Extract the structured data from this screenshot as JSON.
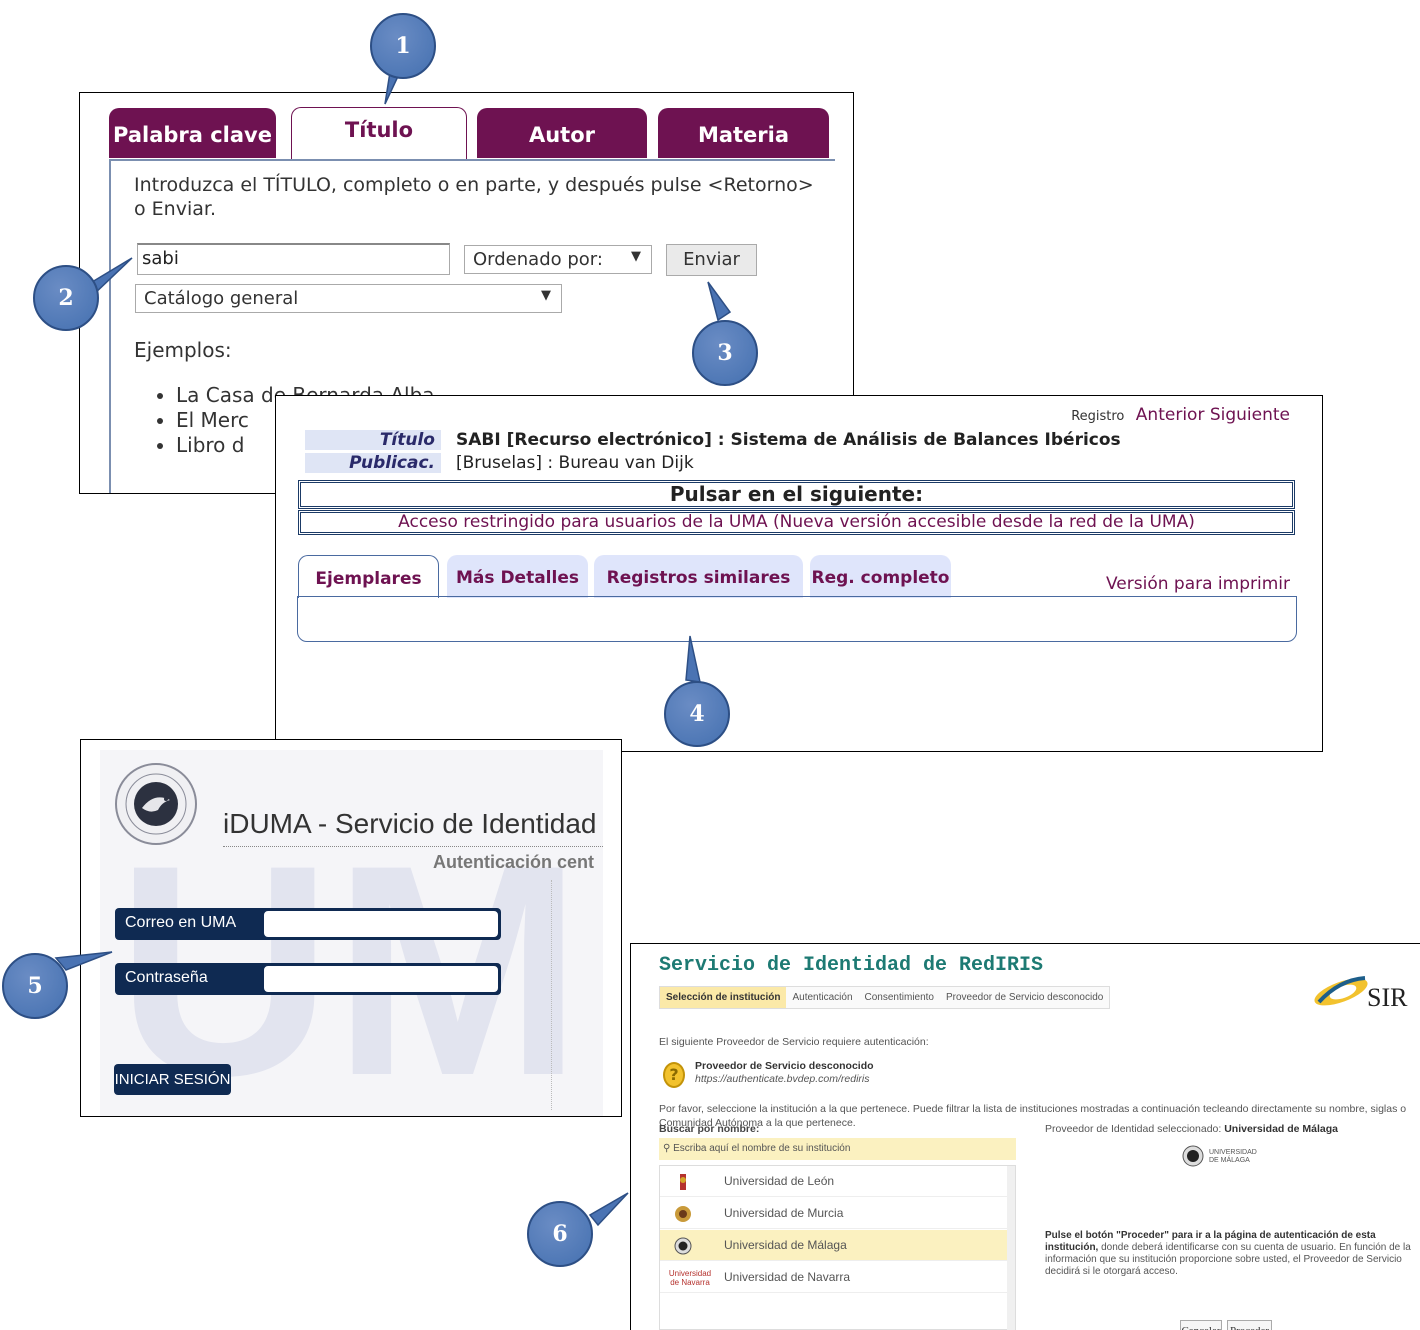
{
  "panel_search": {
    "tabs": [
      "Palabra clave",
      "Título",
      "Autor",
      "Materia"
    ],
    "active_tab": "Título",
    "instruction": "Introduzca el TÍTULO, completo o en parte, y después pulse <Retorno> o Enviar.",
    "search_value": "sabi",
    "sort_label": "Ordenado por:",
    "send_button": "Enviar",
    "catalog_select": "Catálogo general",
    "examples_label": "Ejemplos:",
    "examples": [
      "La Casa de Bernarda Alba",
      "El Merc",
      "Libro d"
    ]
  },
  "panel_record": {
    "nav_label": "Registro",
    "nav_links": "Anterior Siguiente",
    "fields": [
      {
        "label": "Título",
        "value": "SABI [Recurso electrónico] : Sistema de Análisis de Balances Ibéricos"
      },
      {
        "label": "Publicac.",
        "value": "[Bruselas] : Bureau van Dijk"
      }
    ],
    "pulsar_heading": "Pulsar en el siguiente:",
    "access_link": "Acceso restringido para usuarios de la UMA (Nueva versión accesible desde la red de la UMA)",
    "tabs": [
      "Ejemplares",
      "Más Detalles",
      "Registros similares",
      "Reg. completo"
    ],
    "active_tab": "Ejemplares",
    "print_link": "Versión para imprimir"
  },
  "panel_iduma": {
    "title": "iDUMA - Servicio de Identidad",
    "subtitle": "Autenticación cent",
    "email_label": "Correo en UMA",
    "password_label": "Contraseña",
    "login_button": "INICIAR SESIÓN",
    "watermark": "UM"
  },
  "panel_rediris": {
    "title": "Servicio de Identidad de RedIRIS",
    "breadcrumb": [
      "Selección de institución",
      "Autenticación",
      "Consentimiento",
      "Proveedor de Servicio desconocido"
    ],
    "intro": "El siguiente Proveedor de Servicio requiere autenticación:",
    "provider_name": "Proveedor de Servicio desconocido",
    "provider_url": "https://authenticate.bvdep.com/rediris",
    "instructions": "Por favor, seleccione la institución a la que pertenece. Puede filtrar la lista de instituciones mostradas a continuación tecleando directamente su nombre, siglas o Comunidad Autónoma a la que pertenece.",
    "search_label": "Buscar por nombre:",
    "search_placeholder": "Escriba aquí el nombre de su institución",
    "institutions": [
      "Universidad de León",
      "Universidad de Murcia",
      "Universidad de Málaga",
      "Universidad de Navarra"
    ],
    "selected_institution": "Universidad de Málaga",
    "selected_label": "Proveedor de Identidad seleccionado:",
    "logo_text": "UNIVERSIDAD DE MÁLAGA",
    "proceed_text_bold": "Pulse el botón \"Proceder\" para ir a la página de autenticación de esta institución,",
    "proceed_text": "donde deberá identificarse con su cuenta de usuario. En función de la información que su institución proporcione sobre usted, el Proveedor de Servicio decidirá si le otorgará acceso.",
    "cancel_button": "Cancelar",
    "proceed_button": "Proceder",
    "sir_logo": "SIR",
    "navarra_logo": "Universidad de Navarra"
  },
  "markers": [
    "1",
    "2",
    "3",
    "4",
    "5",
    "6"
  ],
  "colors": {
    "accent": "#6e1251",
    "navy": "#0f2a52",
    "marker": "#4a73b3",
    "rediris": "#1d7a73",
    "highlight": "#fbf1c0"
  }
}
